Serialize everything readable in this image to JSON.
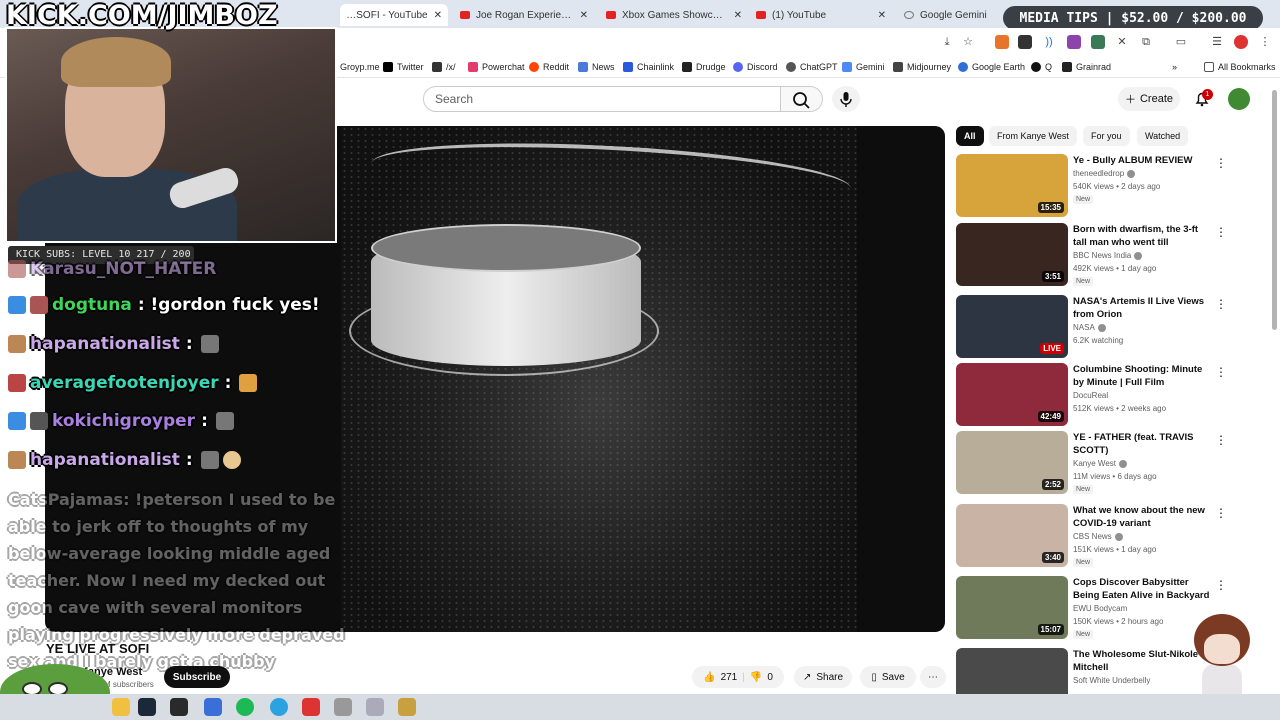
{
  "browser": {
    "tabs": [
      {
        "label": "YE LIVE AT SOFI - YouTube",
        "fav": "youtube-icon"
      },
      {
        "label": "Joe Rogan Experience #2479",
        "fav": "youtube-icon"
      },
      {
        "label": "Xbox Games Showcase Retu",
        "fav": "youtube-icon"
      },
      {
        "label": "(1) YouTube",
        "fav": "youtube-icon"
      },
      {
        "label": "Google Gemini",
        "fav": "globe-icon"
      }
    ],
    "bookmarks": [
      "Groyp.me",
      "Twitter",
      "/x/",
      "Powerchat",
      "Reddit",
      "News",
      "Chainlink",
      "Drudge",
      "Discord",
      "ChatGPT",
      "Gemini",
      "Midjourney",
      "Google Earth",
      "Q",
      "Grainrad"
    ],
    "all_bookmarks": "All Bookmarks"
  },
  "overlay": {
    "media_tips": "MEDIA TIPS | $52.00 / $200.00",
    "kick_handle": "KICK.COM/JIMBOZ",
    "subs_bar": "KICK SUBS: LEVEL 10 217 / 200",
    "chat": [
      {
        "user": "Karasu_NOT_HATER",
        "text": ":",
        "color": "#c9a7e8"
      },
      {
        "user": "dogtuna",
        "text": ":  !gordon fuck yes!",
        "color": "#3dd65a"
      },
      {
        "user": "hapanationalist",
        "text": ":",
        "color": "#c9a7e8"
      },
      {
        "user": "averagefootenjoyer",
        "text": ":",
        "color": "#3ad6b5"
      },
      {
        "user": "kokichigroyper",
        "text": ":",
        "color": "#a97fe0"
      },
      {
        "user": "hapanationalist",
        "text": ":",
        "color": "#c9a7e8"
      }
    ],
    "chat_faded": "CatsPajamas: !peterson I used to be able to jerk off to thoughts of my below-average looking middle aged teacher. Now I need my decked out goon cave with several monitors playing progressively more depraved sex and I barely get a chubby"
  },
  "youtube": {
    "search_placeholder": "Search",
    "create_label": "Create",
    "notif_count": "1",
    "video": {
      "title": "YE LIVE AT SOFI",
      "channel": "Kanye West",
      "subscribers": "M subscribers",
      "subscribe_label": "Subscribe",
      "likes": "271",
      "dislikes": "0",
      "share_label": "Share",
      "save_label": "Save"
    },
    "chips": [
      "All",
      "From Kanye West",
      "For you",
      "Watched"
    ],
    "recommendations": [
      {
        "title": "Ye - Bully ALBUM REVIEW",
        "channel": "theneedledrop",
        "meta": "540K views • 2 days ago",
        "badge": "New",
        "duration": "15:35",
        "verified": true,
        "thumb": "#d7a33b"
      },
      {
        "title": "Born with dwarfism, the 3-ft tall man who went till Supreme ...",
        "channel": "BBC News India",
        "meta": "492K views • 1 day ago",
        "badge": "New",
        "duration": "3:51",
        "verified": true,
        "thumb": "#3a2620"
      },
      {
        "title": "NASA's Artemis II Live Views from Orion",
        "channel": "NASA",
        "meta": "6.2K watching",
        "badge": "",
        "duration": "LIVE",
        "verified": true,
        "thumb": "#2d3442"
      },
      {
        "title": "Columbine Shooting: Minute by Minute | Full Film",
        "channel": "DocuReal",
        "meta": "512K views • 2 weeks ago",
        "badge": "",
        "duration": "42:49",
        "verified": false,
        "thumb": "#8e2a3c"
      },
      {
        "title": "YE - FATHER (feat. TRAVIS SCOTT)",
        "channel": "Kanye West",
        "meta": "11M views • 6 days ago",
        "badge": "New",
        "duration": "2:52",
        "verified": true,
        "thumb": "#b7ad98"
      },
      {
        "title": "What we know about the new COVID-19 variant",
        "channel": "CBS News",
        "meta": "151K views • 1 day ago",
        "badge": "New",
        "duration": "3:40",
        "verified": true,
        "thumb": "#c9b3a4"
      },
      {
        "title": "Cops Discover Babysitter Being Eaten Alive in Backyard",
        "channel": "EWU Bodycam",
        "meta": "150K views • 2 hours ago",
        "badge": "New",
        "duration": "15:07",
        "verified": false,
        "thumb": "#6f7a5a"
      },
      {
        "title": "The Wholesome Slut-Nikole Mitchell",
        "channel": "Soft White Underbelly",
        "meta": "",
        "badge": "",
        "duration": "",
        "verified": false,
        "thumb": "#4a4a4a"
      }
    ]
  }
}
